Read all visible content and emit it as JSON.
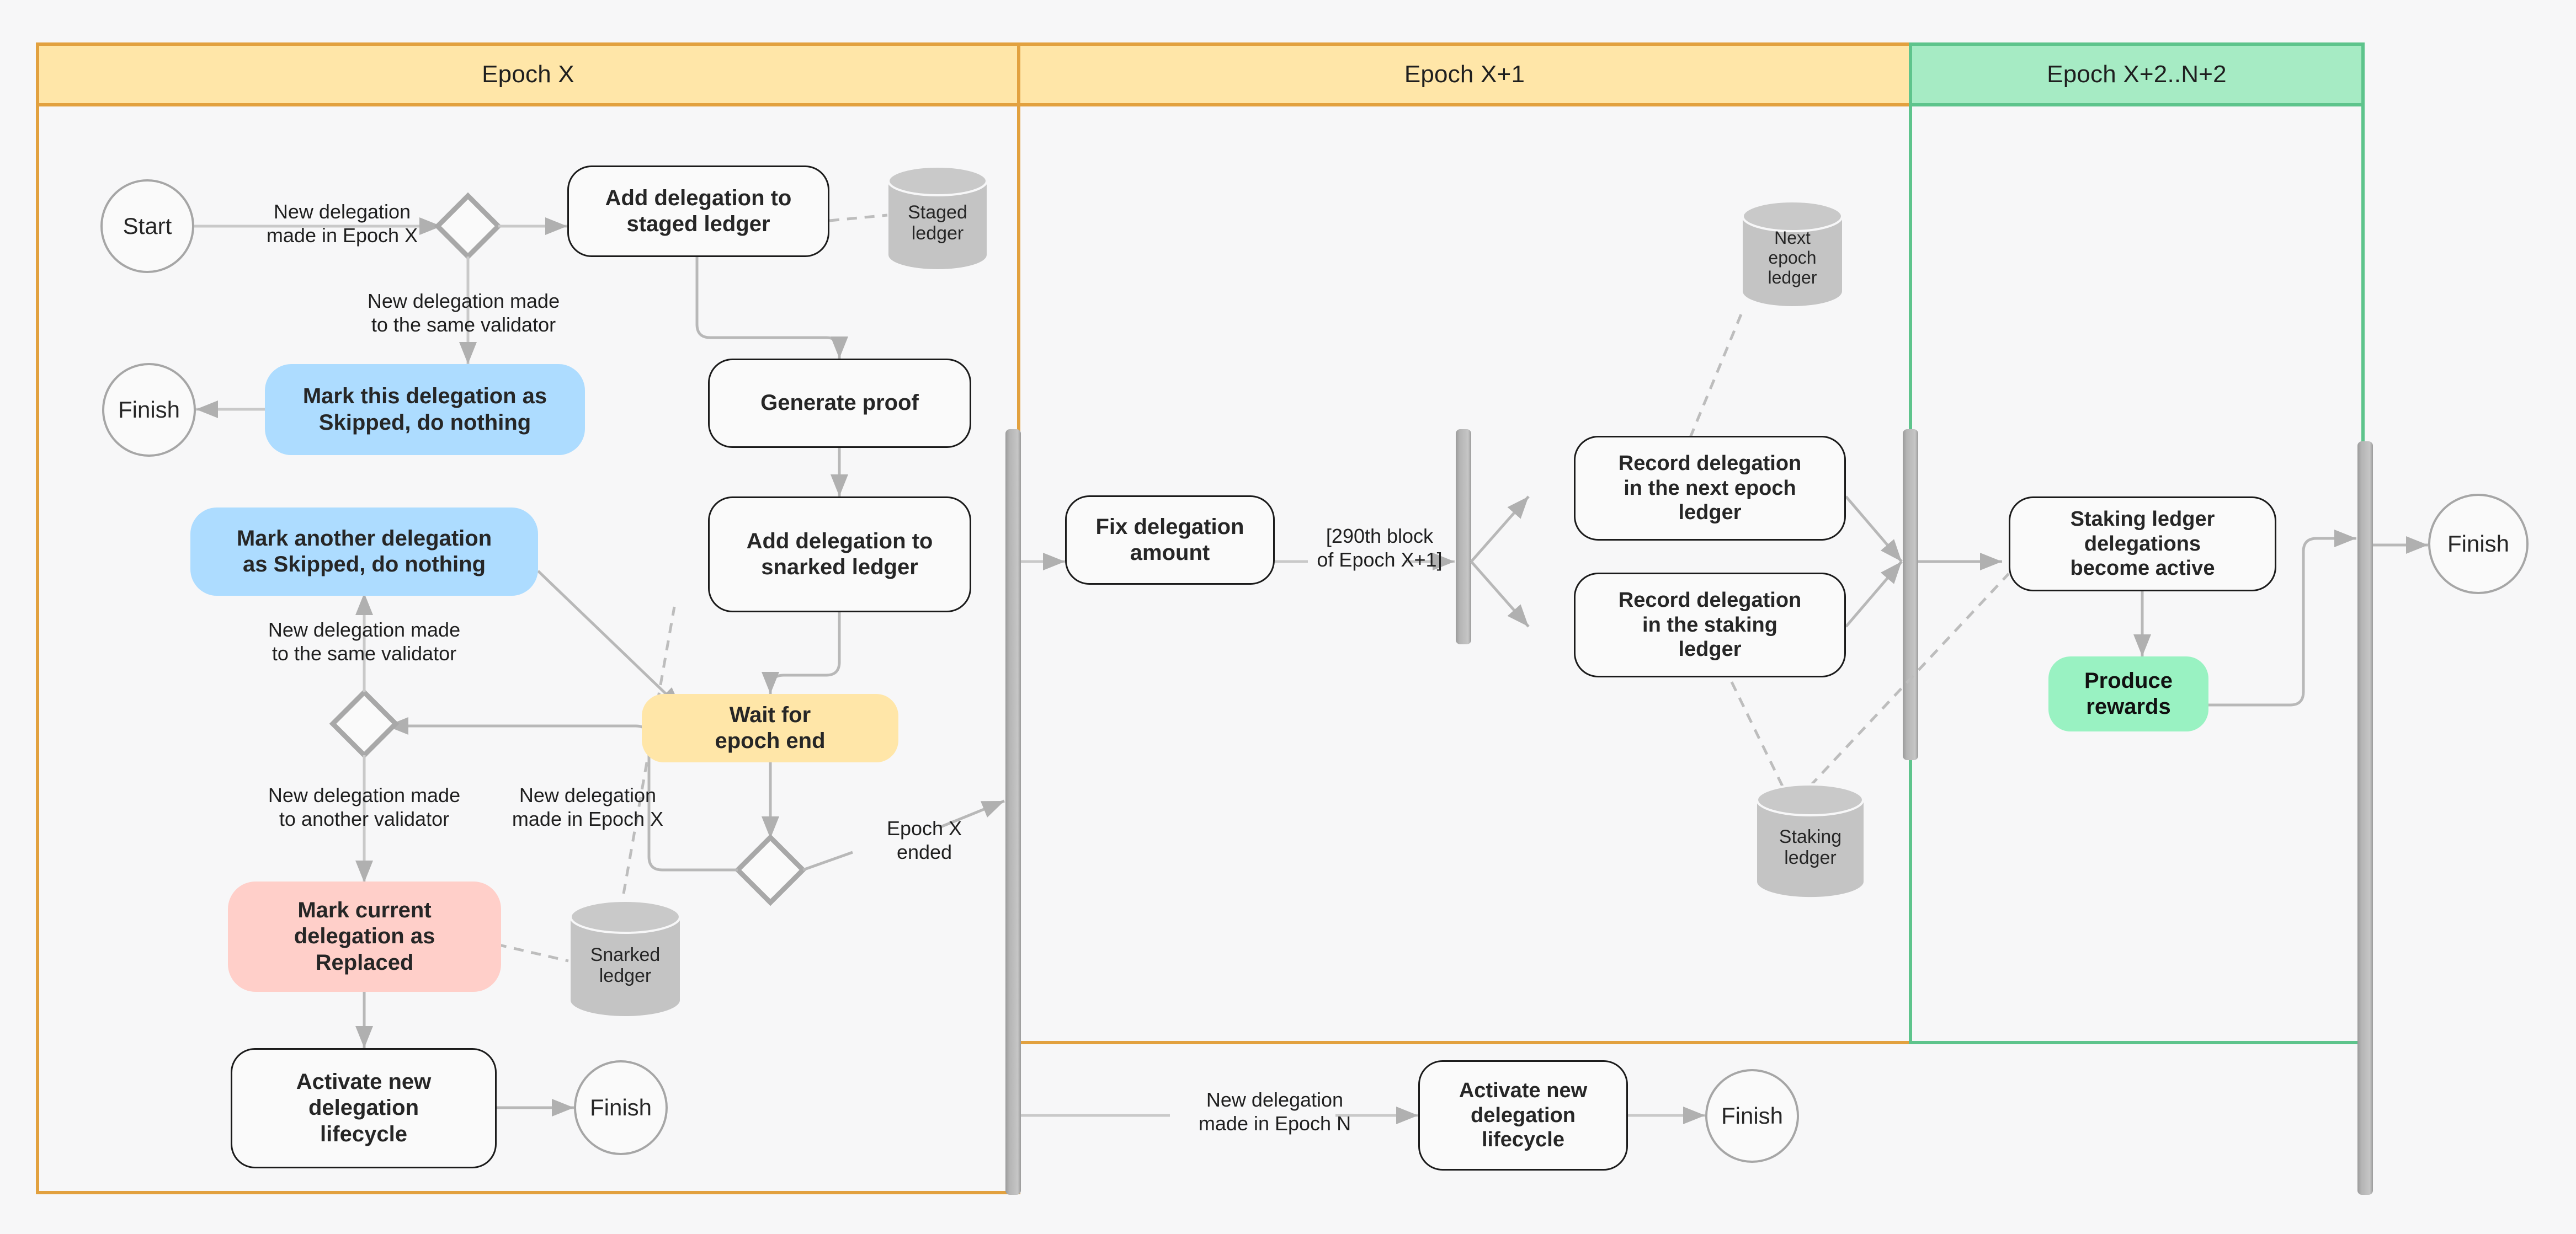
{
  "diagram": {
    "title": "Delegation lifecycle across epochs",
    "background": "#f7f7f8"
  },
  "lanes": [
    {
      "id": "epoch_x",
      "label": "Epoch X",
      "fill": "#ffe6a8",
      "border": "#e2a13f"
    },
    {
      "id": "epoch_x1",
      "label": "Epoch X+1",
      "fill": "#ffe6a8",
      "border": "#e2a13f"
    },
    {
      "id": "epoch_x2n2",
      "label": "Epoch X+2..N+2",
      "fill": "#a6ebc4",
      "border": "#5ec48c"
    }
  ],
  "nodes": {
    "start": {
      "label": "Start",
      "shape": "terminator"
    },
    "add_staged": {
      "label": "Add delegation to\nstaged ledger",
      "shape": "process"
    },
    "staged_ledger": {
      "label": "Staged\nledger",
      "shape": "datastore"
    },
    "finish_top": {
      "label": "Finish",
      "shape": "terminator"
    },
    "mark_this_skipped": {
      "label": "Mark this delegation as\nSkipped, do nothing",
      "shape": "process",
      "fill": "#addcff"
    },
    "generate_proof": {
      "label": "Generate proof",
      "shape": "process"
    },
    "mark_another_skip": {
      "label": "Mark another delegation\nas Skipped, do nothing",
      "shape": "process",
      "fill": "#addcff"
    },
    "add_snarked": {
      "label": "Add delegation to\nsnarked ledger",
      "shape": "process"
    },
    "wait_epoch_end": {
      "label": "Wait for\nepoch end",
      "shape": "process",
      "fill": "#ffe6a8"
    },
    "mark_replaced": {
      "label": "Mark current\ndelegation as\nReplaced",
      "shape": "process",
      "fill": "#ffcfc9"
    },
    "snarked_ledger": {
      "label": "Snarked\nledger",
      "shape": "datastore"
    },
    "activate_left": {
      "label": "Activate new\ndelegation\nlifecycle",
      "shape": "process"
    },
    "finish_left": {
      "label": "Finish",
      "shape": "terminator"
    },
    "fix_amount": {
      "label": "Fix delegation\namount",
      "shape": "process"
    },
    "next_epoch_ledger": {
      "label": "Next\nepoch\nledger",
      "shape": "datastore"
    },
    "record_next": {
      "label": "Record  delegation\nin the next epoch\nledger",
      "shape": "process"
    },
    "record_staking": {
      "label": "Record delegation\nin the staking\nledger",
      "shape": "process"
    },
    "staking_ledger": {
      "label": "Staking\nledger",
      "shape": "datastore"
    },
    "staking_active": {
      "label": "Staking ledger\ndelegations\nbecome active",
      "shape": "process"
    },
    "produce_rewards": {
      "label": "Produce\nrewards",
      "shape": "process",
      "fill": "#99f2c2"
    },
    "finish_right": {
      "label": "Finish",
      "shape": "terminator"
    },
    "activate_bottom": {
      "label": "Activate new\ndelegation\nlifecycle",
      "shape": "process"
    },
    "finish_bottom": {
      "label": "Finish",
      "shape": "terminator"
    }
  },
  "edge_labels": {
    "new_del_epoch_x_top": "New delegation\nmade in Epoch X",
    "same_validator_top": "New delegation made\nto the same validator",
    "same_validator_mid": "New delegation made\nto the same validator",
    "another_validator": "New delegation made\nto another validator",
    "new_del_epoch_x_mid": "New delegation\nmade in Epoch X",
    "epoch_x_ended": "Epoch X\nended",
    "block_290": "[290th block\nof Epoch X+1]",
    "new_del_epoch_n": "New delegation\nmade in Epoch N"
  },
  "colors": {
    "lane_amber_fill": "#ffe6a8",
    "lane_amber_border": "#e2a13f",
    "lane_green_fill": "#a6ebc4",
    "lane_green_border": "#5ec48c",
    "node_blue": "#addcff",
    "node_pink": "#ffcfc9",
    "node_amber": "#ffe6a8",
    "node_green": "#99f2c2",
    "datastore_grey": "#c4c4c4",
    "connector_grey": "#b0b0b0",
    "sync_bar_grey": "#ababab",
    "text_dark": "#262626"
  }
}
